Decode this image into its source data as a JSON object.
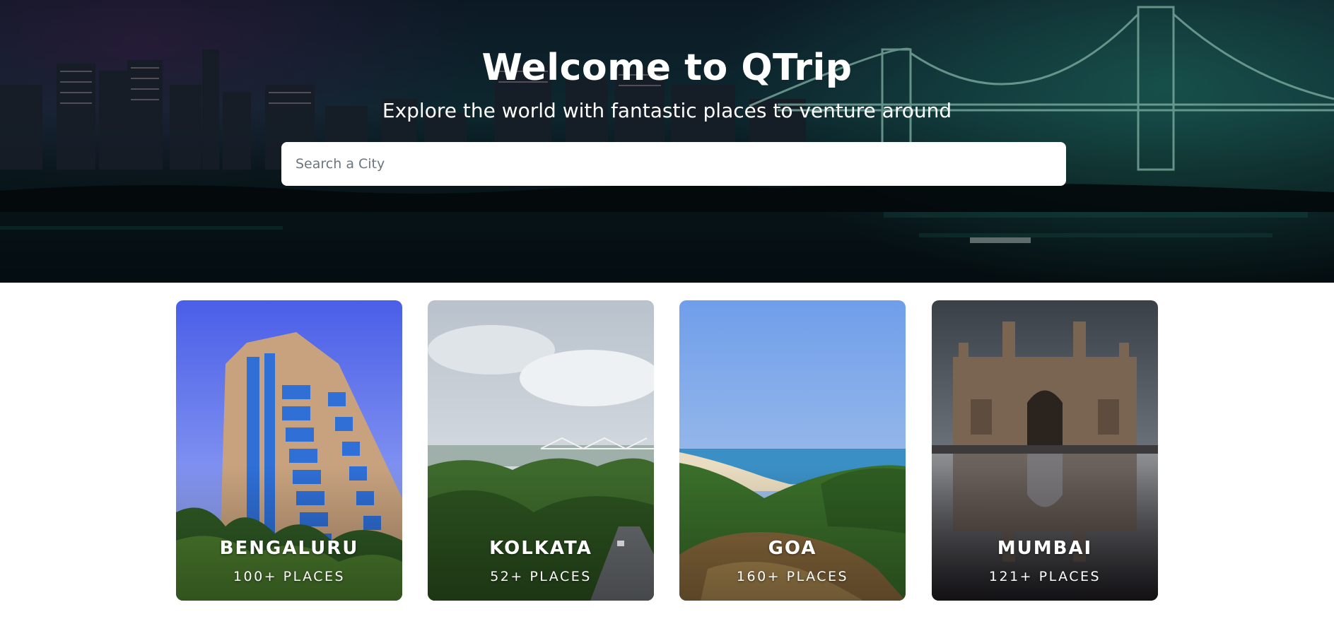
{
  "hero": {
    "title": "Welcome to QTrip",
    "subtitle": "Explore the world with fantastic places to venture around",
    "search_placeholder": "Search a City"
  },
  "cities": [
    {
      "name": "BENGALURU",
      "places": "100+ PLACES"
    },
    {
      "name": "KOLKATA",
      "places": "52+ PLACES"
    },
    {
      "name": "GOA",
      "places": "160+ PLACES"
    },
    {
      "name": "MUMBAI",
      "places": "121+ PLACES"
    }
  ],
  "colors": {
    "hero_bg": "#10303a",
    "hero_accent": "#2a8c78",
    "card_text": "#ffffff"
  }
}
